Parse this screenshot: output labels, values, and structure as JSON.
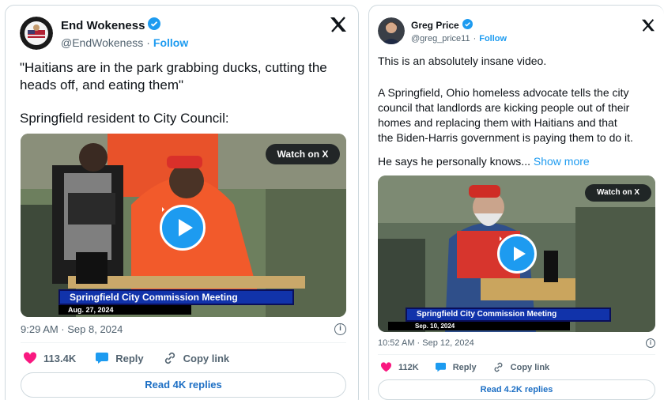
{
  "tweets": [
    {
      "display_name": "End Wokeness",
      "handle": "@EndWokeness",
      "follow_label": "Follow",
      "text_lines": [
        "\"Haitians are in the park grabbing ducks, cutting the",
        "heads off, and eating them\""
      ],
      "text_second": "Springfield resident to City Council:",
      "watch_label": "Watch on X",
      "caption": "Springfield City Commission Meeting",
      "caption_date": "Aug. 27, 2024",
      "timestamp": "9:29 AM · Sep 8, 2024",
      "likes": "113.4K",
      "reply_label": "Reply",
      "copy_label": "Copy link",
      "replies_label": "Read 4K replies"
    },
    {
      "display_name": "Greg Price",
      "handle": "@greg_price11",
      "follow_label": "Follow",
      "text_first": "This is an absolutely insane video.",
      "text_lines": [
        "A Springfield, Ohio homeless advocate tells the city",
        "council that landlords are kicking people out of their",
        "homes and replacing them with Haitians and that",
        "the Biden-Harris government is paying them to do it."
      ],
      "text_last": "He says he personally knows...",
      "show_more": "Show more",
      "watch_label": "Watch on X",
      "caption": "Springfield City Commission Meeting",
      "caption_date": "Sep. 10, 2024",
      "timestamp": "10:52 AM · Sep 12, 2024",
      "likes": "112K",
      "reply_label": "Reply",
      "copy_label": "Copy link",
      "replies_label": "Read 4.2K replies"
    }
  ],
  "colors": {
    "like": "#f91880",
    "link": "#1d9bf0",
    "caption_bg": "#1133aa"
  },
  "icons": [
    "verified-icon",
    "x-logo-icon",
    "play-icon",
    "info-icon",
    "heart-icon",
    "reply-bubble-icon",
    "link-icon"
  ]
}
